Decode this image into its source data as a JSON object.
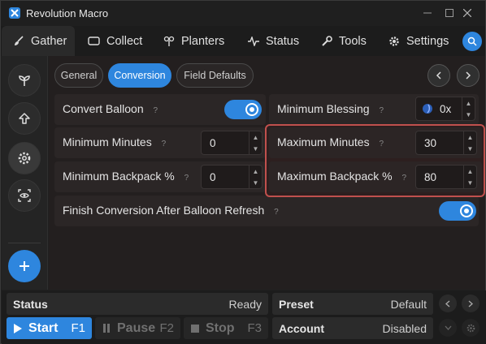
{
  "window": {
    "title": "Revolution Macro"
  },
  "tabs": [
    {
      "label": "Gather",
      "icon": "broom-icon",
      "active": true
    },
    {
      "label": "Collect",
      "icon": "ticket-icon",
      "active": false
    },
    {
      "label": "Planters",
      "icon": "sprout-icon",
      "active": false
    },
    {
      "label": "Status",
      "icon": "pulse-icon",
      "active": false
    },
    {
      "label": "Tools",
      "icon": "wrench-icon",
      "active": false
    },
    {
      "label": "Settings",
      "icon": "gear-icon",
      "active": false
    }
  ],
  "subtabs": [
    {
      "label": "General",
      "active": false
    },
    {
      "label": "Conversion",
      "active": true
    },
    {
      "label": "Field Defaults",
      "active": false
    }
  ],
  "conversion": {
    "convert_balloon": {
      "label": "Convert Balloon",
      "help": "?",
      "enabled": true
    },
    "minimum_blessing": {
      "label": "Minimum Blessing",
      "help": "?",
      "value": "0x"
    },
    "minimum_minutes": {
      "label": "Minimum Minutes",
      "help": "?",
      "value": "0"
    },
    "maximum_minutes": {
      "label": "Maximum Minutes",
      "help": "?",
      "value": "30"
    },
    "minimum_backpack": {
      "label": "Minimum Backpack %",
      "help": "?",
      "value": "0"
    },
    "maximum_backpack": {
      "label": "Maximum Backpack %",
      "help": "?",
      "value": "80"
    },
    "finish_conversion": {
      "label": "Finish Conversion After Balloon Refresh",
      "help": "?",
      "enabled": true
    }
  },
  "bottom": {
    "status_label": "Status",
    "status_value": "Ready",
    "preset_label": "Preset",
    "preset_value": "Default",
    "account_label": "Account",
    "account_value": "Disabled",
    "start_label": "Start",
    "start_key": "F1",
    "pause_label": "Pause",
    "pause_key": "F2",
    "stop_label": "Stop",
    "stop_key": "F3"
  },
  "colors": {
    "accent": "#2e86de",
    "highlight": "#c0504d"
  }
}
